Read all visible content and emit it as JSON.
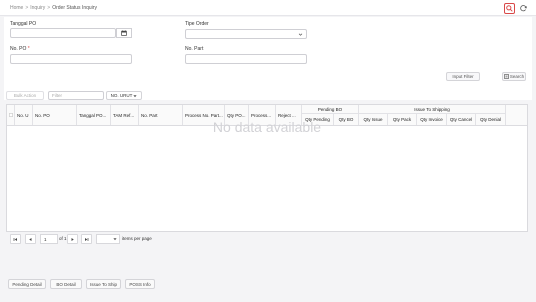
{
  "breadcrumb": {
    "home": "Home",
    "section": "Inquiry",
    "page": "Order Status Inquiry"
  },
  "filters": {
    "tanggal_po_label": "Tanggal PO",
    "tipe_order_label": "Tipe Order",
    "no_po_label": "No. PO",
    "no_po_required": "*",
    "no_part_label": "No. Part",
    "tanggal_po_value": "",
    "tipe_order_value": "",
    "no_po_value": "",
    "no_part_value": ""
  },
  "buttons": {
    "input_filter": "Input Filter",
    "search": "Search"
  },
  "toolbar": {
    "bulk_action": "Bulk Action",
    "filter_placeholder": "Filter",
    "column_select": "NO. URUT"
  },
  "table": {
    "headers": {
      "no_urut": "No. U",
      "no_po": "No. PO",
      "tanggal_po": "Tanggal PO...",
      "tam_ref": "TAM Ref...",
      "no_part": "No. Part",
      "process_no_part": "Process No. Part...",
      "qty_po": "Qty PO...",
      "process": "Process...",
      "reject": "Reject ...",
      "pending_bo": "Pending BO",
      "qty_pending": "Qty Pending",
      "qty_bo": "Qty BO",
      "issue_to_shipping": "Issue To Shipping",
      "qty_issue": "Qty Issue",
      "qty_pack": "Qty Pack",
      "qty_invoice": "Qty Invoice",
      "qty_cancel": "Qty Cancel",
      "qty_denial": "Qty Denial"
    },
    "empty_text": "No data available"
  },
  "pagination": {
    "page": "1",
    "of": "of 1",
    "per_page_label": "items per page",
    "per_page_value": ""
  },
  "footer_buttons": {
    "pending_detail": "Pending Detail",
    "bo_detail": "BO Detail",
    "issue_to_ship": "Issue To Ship",
    "poss_info": "POSS Info"
  },
  "colors": {
    "accent": "#d94848",
    "border": "#cfcfd4"
  }
}
